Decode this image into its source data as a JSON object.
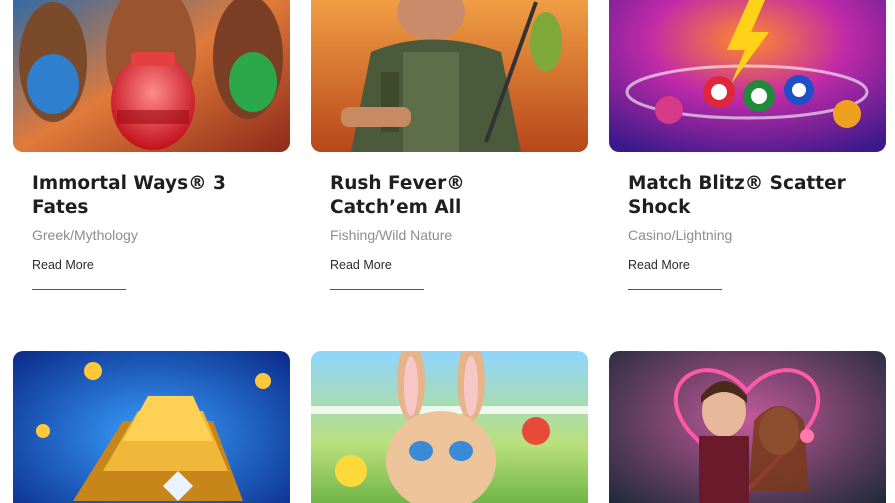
{
  "games_row1": [
    {
      "title": "Immortal Ways® 3 Fates",
      "category": "Greek/Mythology",
      "link_label": "Read More",
      "image_icon": "greek-goddesses-vases-art"
    },
    {
      "title": "Rush Fever® Catch’em All",
      "category": "Fishing/Wild Nature",
      "link_label": "Read More",
      "image_icon": "fisherman-art"
    },
    {
      "title": "Match Blitz® Scatter Shock",
      "category": "Casino/Lightning",
      "link_label": "Read More",
      "image_icon": "lightning-casino-chips-art"
    }
  ],
  "games_row2": [
    {
      "image_icon": "gold-bars-diamonds-art"
    },
    {
      "image_icon": "bunny-farm-art"
    },
    {
      "image_icon": "romance-couple-art"
    }
  ]
}
